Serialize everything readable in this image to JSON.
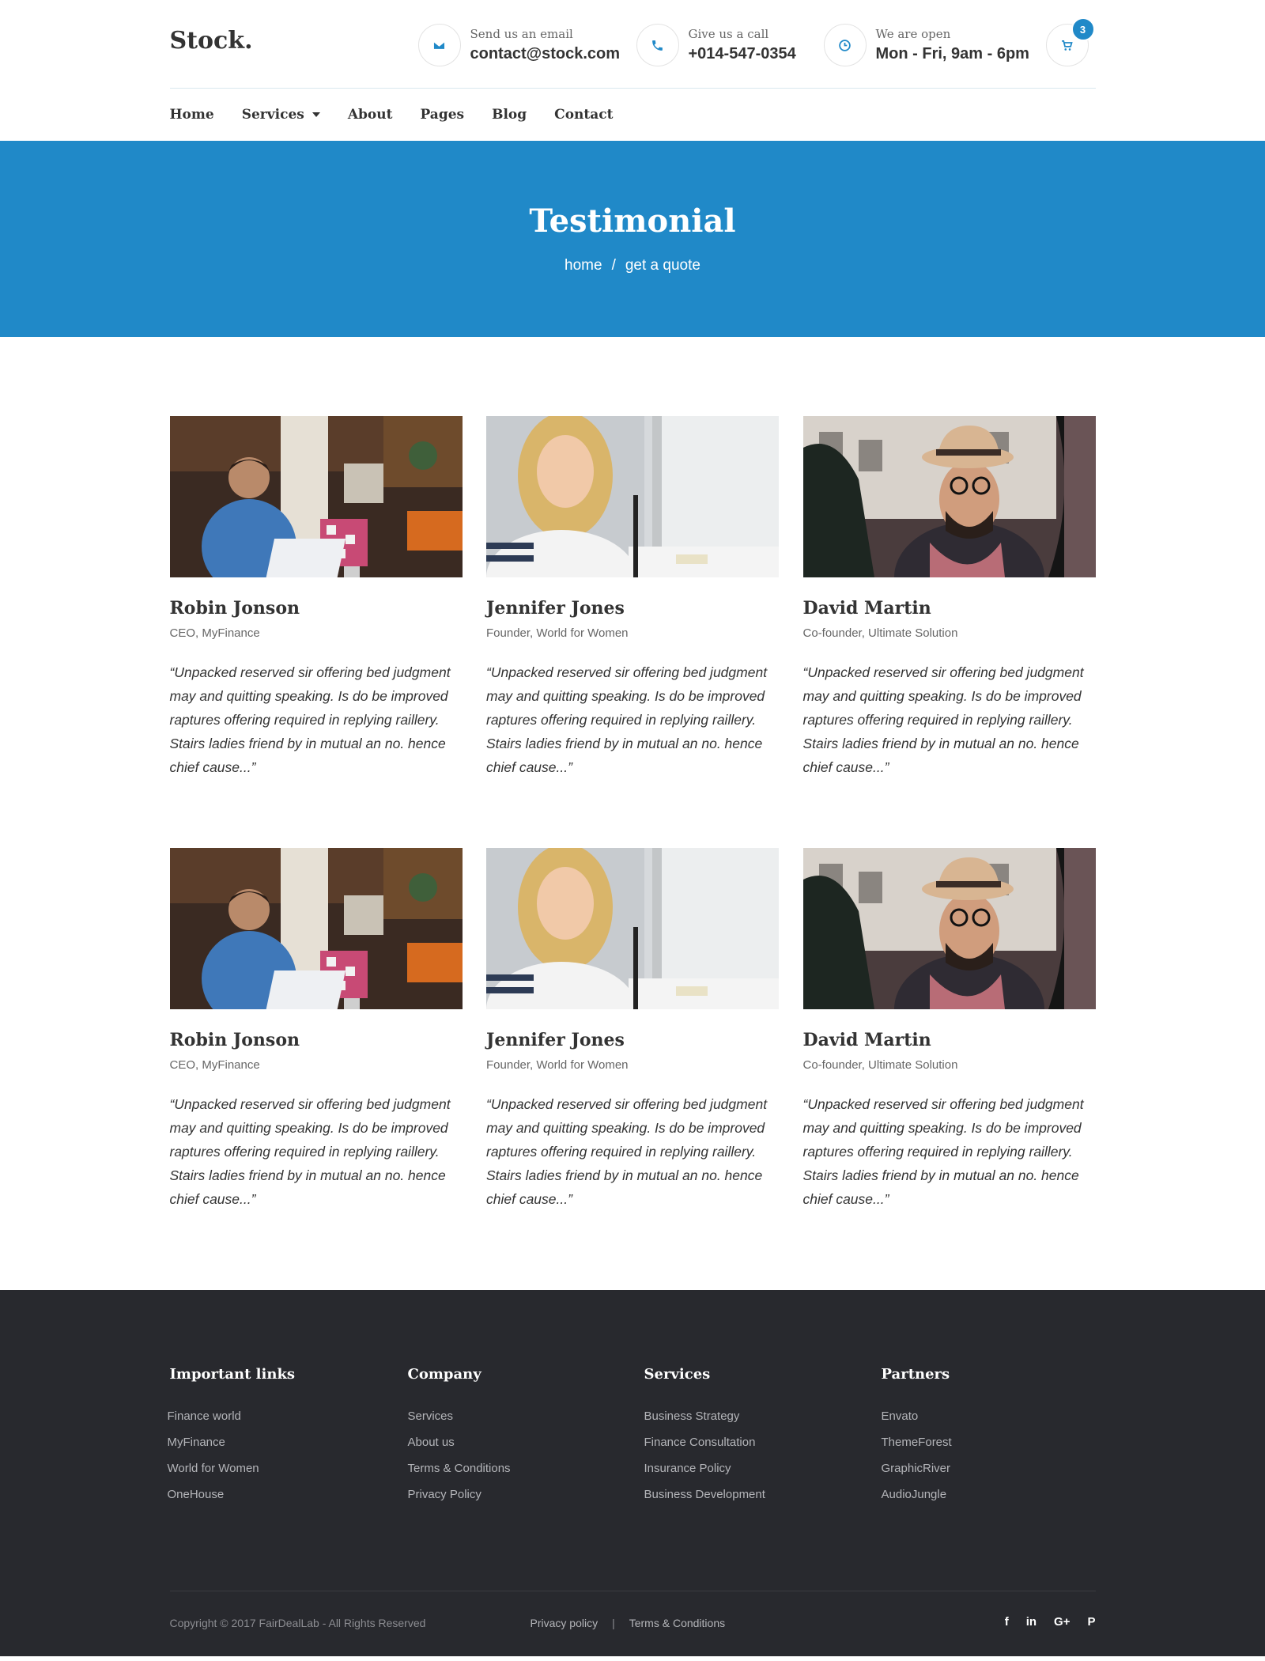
{
  "header": {
    "logo": "Stock.",
    "email": {
      "label": "Send us an email",
      "value": "contact@stock.com"
    },
    "phone": {
      "label": "Give us a call",
      "value": "+014-547-0354"
    },
    "hours": {
      "label": "We are open",
      "value": "Mon - Fri, 9am - 6pm"
    },
    "cart_count": "3"
  },
  "nav": {
    "items": [
      "Home",
      "Services",
      "About",
      "Pages",
      "Blog",
      "Contact"
    ]
  },
  "hero": {
    "title": "Testimonial",
    "breadcrumb": [
      "home",
      "/",
      "get a quote"
    ]
  },
  "testimonials": [
    {
      "name": "Robin Jonson",
      "role": "CEO, MyFinance",
      "quote": "“Unpacked reserved sir offering bed judgment may and quitting speaking. Is do be improved raptures offering required in replying raillery. Stairs ladies friend by in mutual an no. hence chief cause...”"
    },
    {
      "name": "Jennifer Jones",
      "role": "Founder, World for Women",
      "quote": "“Unpacked reserved sir offering bed judgment may and quitting speaking. Is do be improved raptures offering required in replying raillery. Stairs ladies friend by in mutual an no. hence chief cause...”"
    },
    {
      "name": "David Martin",
      "role": "Co-founder, Ultimate Solution",
      "quote": "“Unpacked reserved sir offering bed judgment may and quitting speaking. Is do be improved raptures offering required in replying raillery. Stairs ladies friend by in mutual an no. hence chief cause...”"
    },
    {
      "name": "Robin Jonson",
      "role": "CEO, MyFinance",
      "quote": "“Unpacked reserved sir offering bed judgment may and quitting speaking. Is do be improved raptures offering required in replying raillery. Stairs ladies friend by in mutual an no. hence chief cause...”"
    },
    {
      "name": "Jennifer Jones",
      "role": "Founder, World for Women",
      "quote": "“Unpacked reserved sir offering bed judgment may and quitting speaking. Is do be improved raptures offering required in replying raillery. Stairs ladies friend by in mutual an no. hence chief cause...”"
    },
    {
      "name": "David Martin",
      "role": "Co-founder, Ultimate Solution",
      "quote": "“Unpacked reserved sir offering bed judgment may and quitting speaking. Is do be improved raptures offering required in replying raillery. Stairs ladies friend by in mutual an no. hence chief cause...”"
    }
  ],
  "footer": {
    "columns": [
      {
        "title": "Important links",
        "items": [
          "Finance world",
          "MyFinance",
          "World for Women",
          "OneHouse"
        ]
      },
      {
        "title": "Company",
        "items": [
          "Services",
          "About us",
          "Terms & Conditions",
          "Privacy Policy"
        ]
      },
      {
        "title": "Services",
        "items": [
          "Business Strategy",
          "Finance Consultation",
          "Insurance Policy",
          "Business Development"
        ]
      },
      {
        "title": "Partners",
        "items": [
          "Envato",
          "ThemeForest",
          "GraphicRiver",
          "AudioJungle"
        ]
      }
    ],
    "copyright": "Copyright © 2017 FairDealLab - All Rights Reserved",
    "bottom_links": [
      "Privacy policy",
      "|",
      "Terms & Conditions"
    ],
    "social": [
      "f",
      "in",
      "G+",
      "P"
    ]
  },
  "colors": {
    "accent": "#2089c8",
    "footer_bg": "#28292e"
  },
  "icons": {
    "email": "envelope-icon",
    "phone": "phone-icon",
    "hours": "clock-icon",
    "cart": "cart-icon",
    "social": [
      "facebook-icon",
      "linkedin-icon",
      "google-plus-icon",
      "pinterest-icon"
    ]
  }
}
